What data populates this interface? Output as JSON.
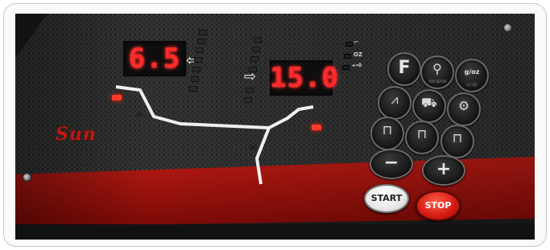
{
  "display_left": {
    "value": "6.5"
  },
  "display_right": {
    "value": "15.0"
  },
  "options": {
    "oz_label": "OZ",
    "zero_label": "◂→0"
  },
  "buttons": {
    "f_label": "F",
    "settings_caption": "TOP SETUP",
    "grams_label": "g/oz",
    "grams_caption": "G / OZ",
    "minus_label": "−",
    "plus_label": "+",
    "start_label": "START",
    "stop_label": "STOP"
  },
  "brand": {
    "logo_text": "Sun"
  },
  "colors": {
    "accent": "#d41a12",
    "led": "#ff2a2a",
    "panel": "#2b2b2b"
  }
}
